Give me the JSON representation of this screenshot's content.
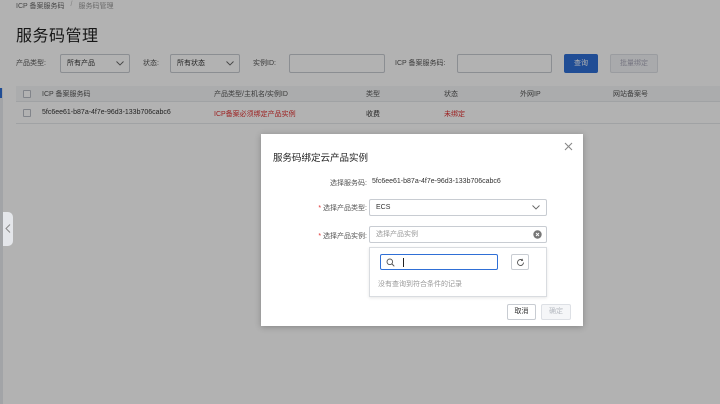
{
  "breadcrumb": {
    "root": "ICP 备案服务码",
    "separator": "/",
    "current": "服务码管理"
  },
  "page_title": "服务码管理",
  "filters": {
    "product_type_label": "产品类型:",
    "product_type_value": "所有产品",
    "status_label": "状态:",
    "status_value": "所有状态",
    "instance_label": "实例ID:",
    "instance_value": "",
    "code_label": "ICP 备案服务码:",
    "code_value": "",
    "query_button": "查询",
    "batch_bind_button": "批量绑定"
  },
  "table": {
    "headers": [
      "ICP 备案服务码",
      "产品类型/主机名/实例ID",
      "类型",
      "状态",
      "外网IP",
      "网站备案号"
    ],
    "rows": [
      {
        "code": "5fc6ee61-b87a-4f7e-96d3-133b706cabc6",
        "product": "ICP备案必须绑定产品实例",
        "type": "收费",
        "status": "未绑定",
        "ip": "",
        "record": ""
      }
    ]
  },
  "modal": {
    "title": "服务码绑定云产品实例",
    "code_label": "选择服务码:",
    "code_value": "5fc6ee61-b87a-4f7e-96d3-133b706cabc6",
    "product_type_label": "选择产品类型:",
    "product_type_value": "ECS",
    "instance_label": "选择产品实例:",
    "instance_placeholder": "选择产品实例",
    "required_mark": "*",
    "dropdown": {
      "search_value": "",
      "empty_text": "没有查询到符合条件的记录"
    },
    "cancel_button": "取消",
    "confirm_button": "确定"
  },
  "colors": {
    "primary": "#2f6fd6",
    "error": "#e02f2f",
    "overlay": "rgba(0,0,0,0.30)"
  }
}
